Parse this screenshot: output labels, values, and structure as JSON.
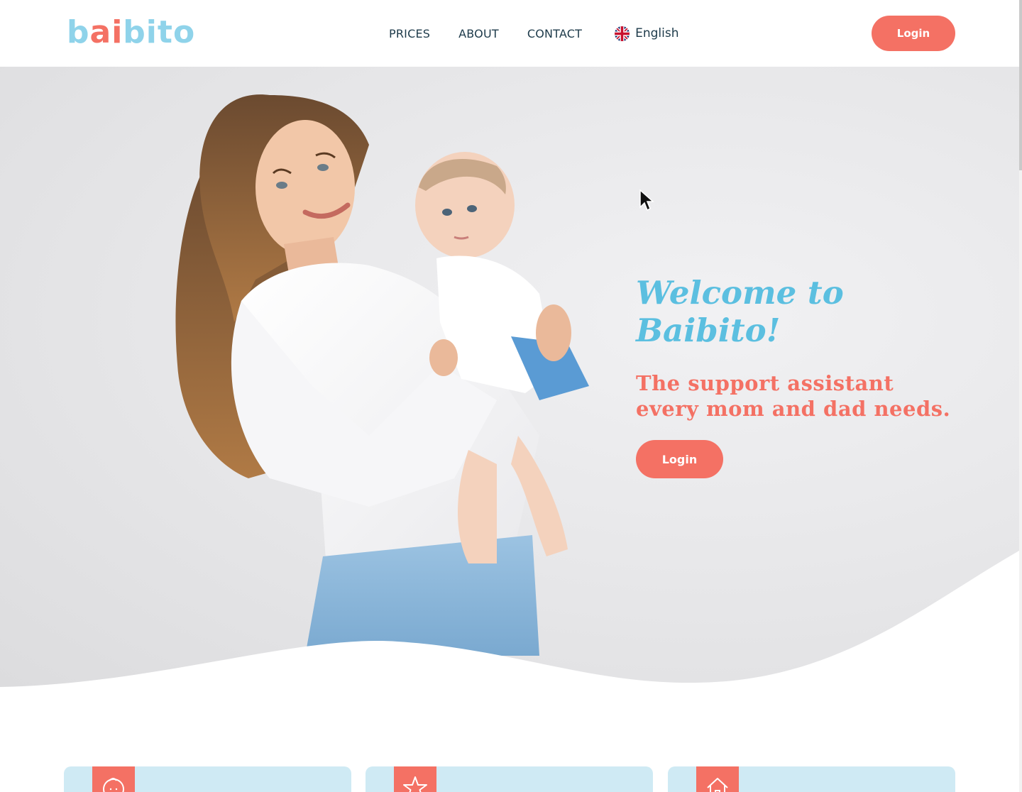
{
  "header": {
    "logo": {
      "letters": [
        "b",
        "a",
        "i",
        "b",
        "i",
        "t",
        "o"
      ]
    },
    "nav": [
      {
        "label": "PRICES"
      },
      {
        "label": "ABOUT"
      },
      {
        "label": "CONTACT"
      }
    ],
    "language": {
      "label": "English",
      "icon": "uk-flag-icon"
    },
    "login_label": "Login"
  },
  "hero": {
    "title": "Welcome to Baibito!",
    "subtitle": "The support assistant every mom and dad needs.",
    "login_label": "Login",
    "image": "mother-holding-baby-photo"
  },
  "feature_cards": [
    {
      "icon": "baby-face-icon"
    },
    {
      "icon": "star-icon"
    },
    {
      "icon": "home-icon"
    }
  ],
  "colors": {
    "accent": "#f47164",
    "brand_blue": "#5bbfe0",
    "card_bg": "#cfeaf4",
    "nav_text": "#1d3a4a"
  }
}
